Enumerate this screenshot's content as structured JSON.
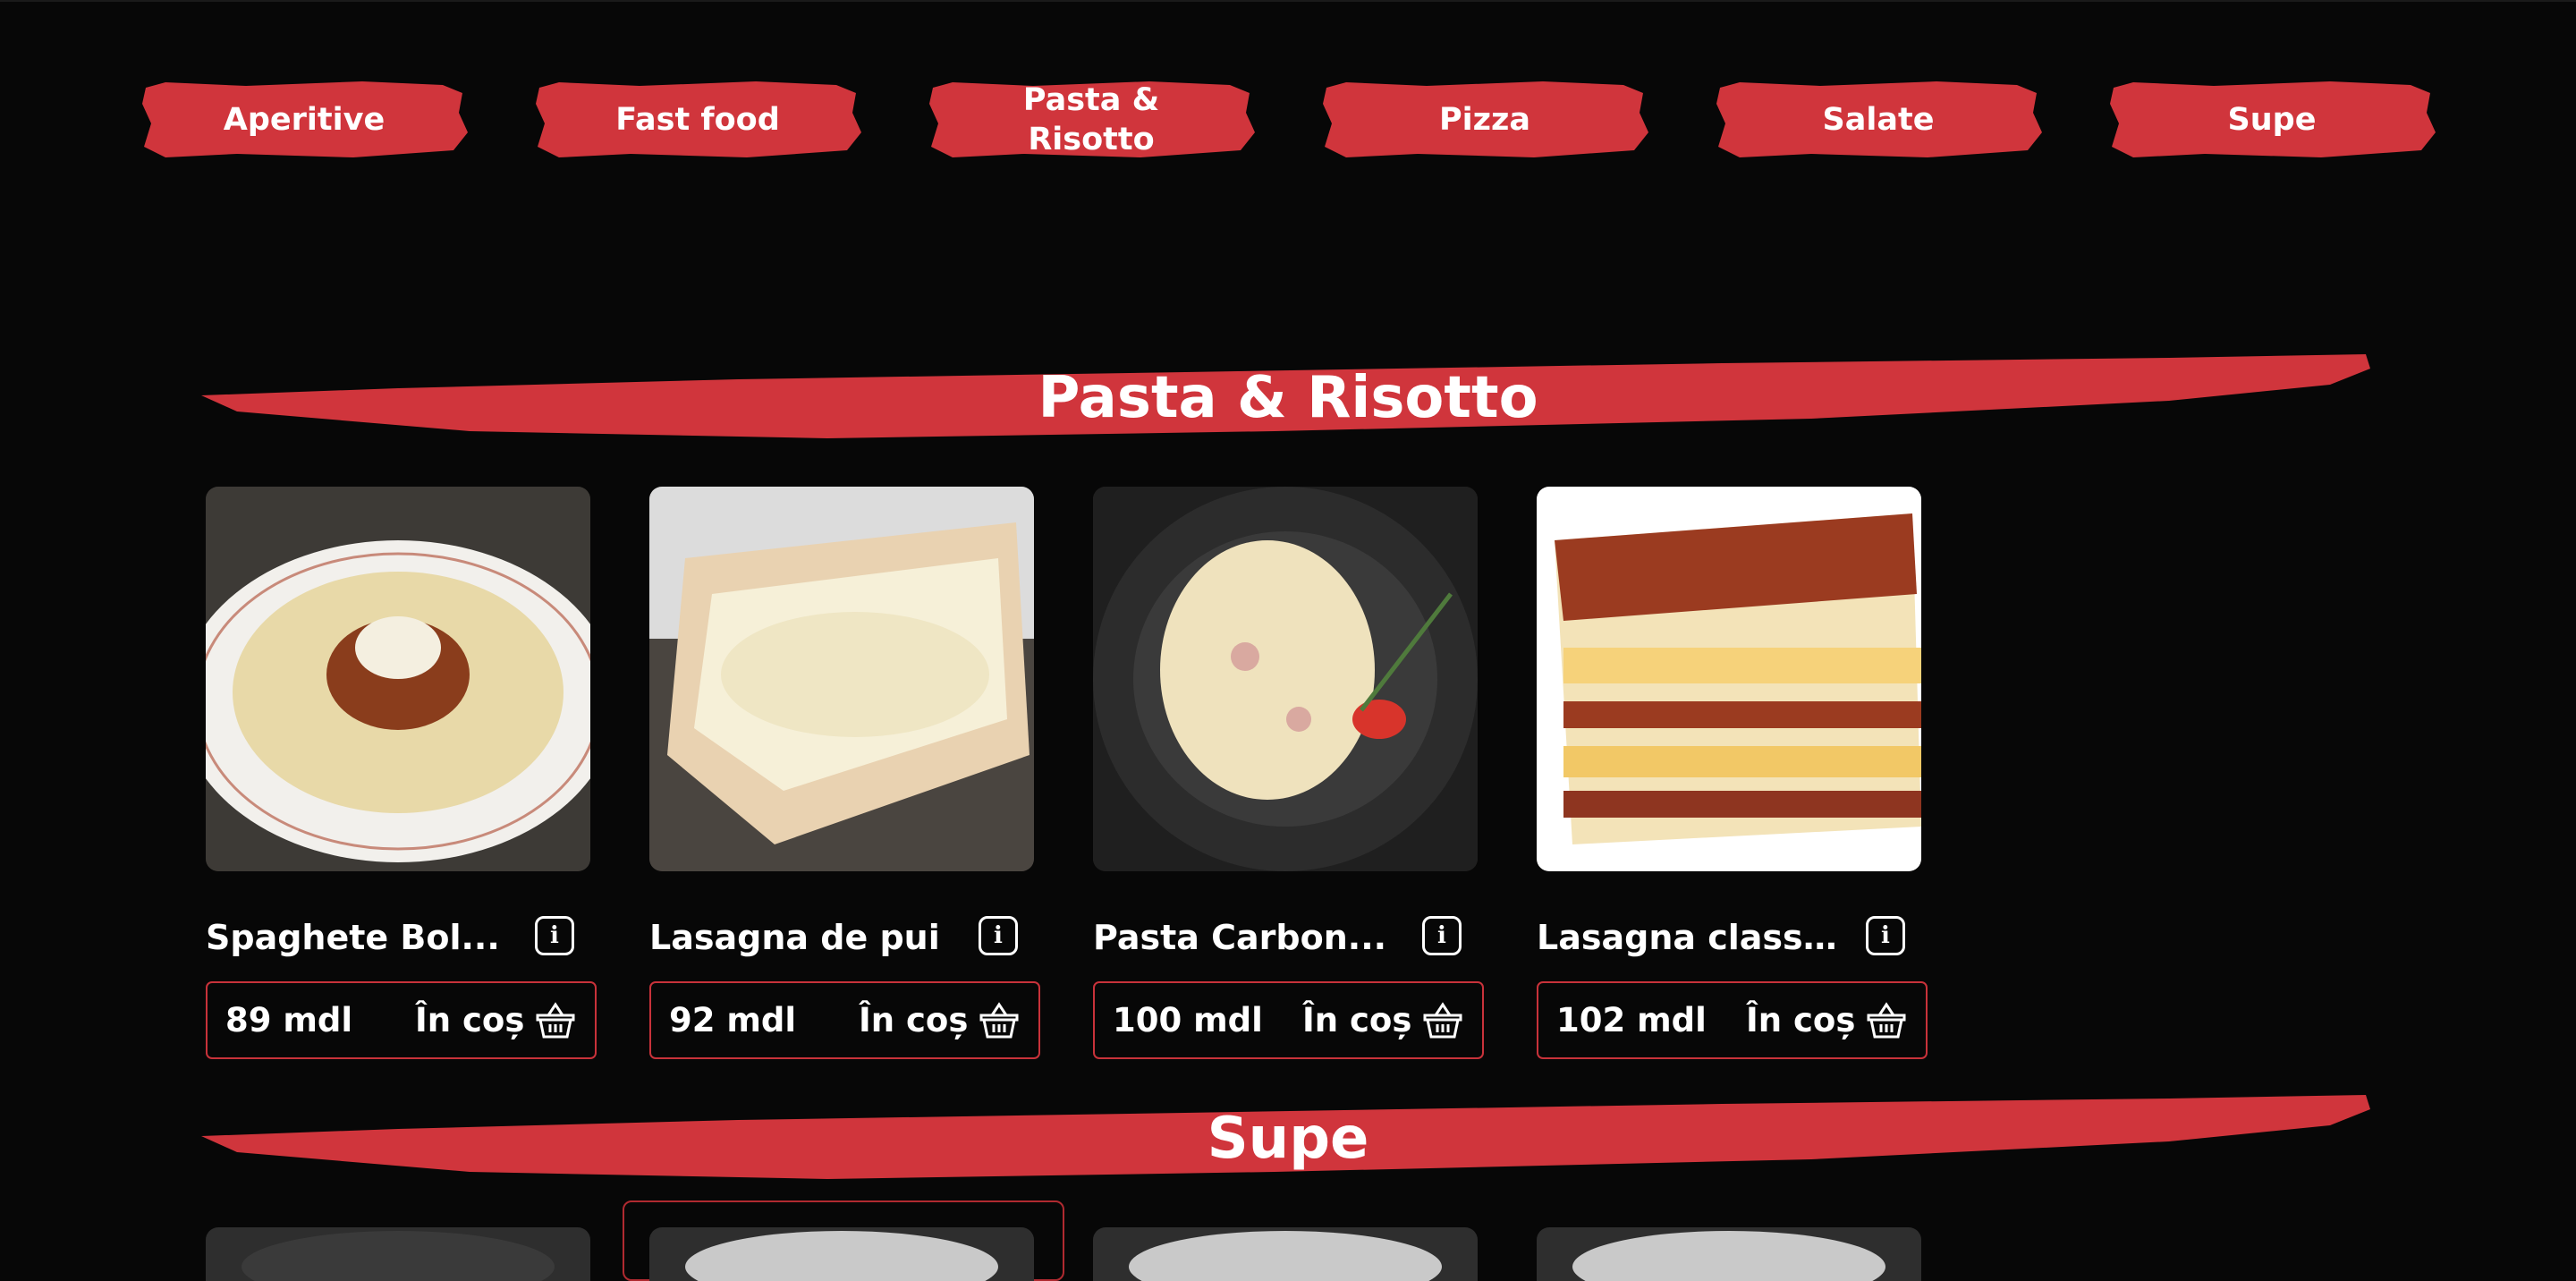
{
  "categories": [
    {
      "label": "Aperitive"
    },
    {
      "label": "Fast food"
    },
    {
      "label": "Pasta & Risotto"
    },
    {
      "label": "Pizza"
    },
    {
      "label": "Salate"
    },
    {
      "label": "Supe"
    }
  ],
  "sections": [
    {
      "title": "Pasta & Risotto"
    },
    {
      "title": "Supe"
    }
  ],
  "products": [
    {
      "name": "Spaghete Bol...",
      "price": "89 mdl",
      "cart_label": "În coș"
    },
    {
      "name": "Lasagna de pui",
      "price": "92 mdl",
      "cart_label": "În coș"
    },
    {
      "name": "Pasta Carbon...",
      "price": "100 mdl",
      "cart_label": "În coș"
    },
    {
      "name": "Lasagna classi...",
      "price": "102 mdl",
      "cart_label": "În coș"
    }
  ],
  "info_glyph": "i",
  "colors": {
    "accent": "#d0353c",
    "background": "#070707",
    "border": "#c8323a"
  }
}
